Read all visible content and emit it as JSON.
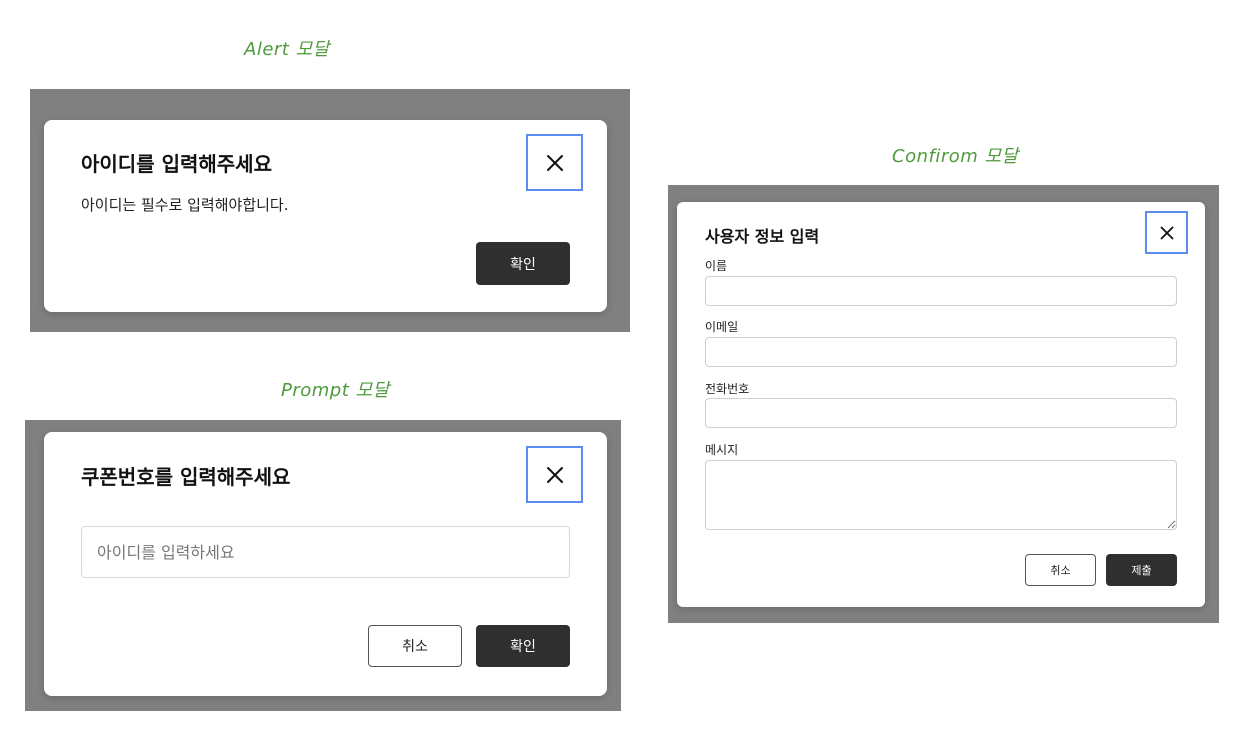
{
  "alert": {
    "caption": "Alert 모달",
    "title": "아이디를 입력해주세요",
    "message": "아이디는 필수로 입력해야합니다.",
    "close_icon": "close-icon",
    "confirm_label": "확인"
  },
  "prompt": {
    "caption": "Prompt 모달",
    "title": "쿠폰번호를 입력해주세요",
    "input_value": "",
    "input_placeholder": "아이디를 입력하세요",
    "close_icon": "close-icon",
    "cancel_label": "취소",
    "confirm_label": "확인"
  },
  "confirm": {
    "caption": "Confirom 모달",
    "title": "사용자 정보 입력",
    "close_icon": "close-icon",
    "fields": {
      "name_label": "이름",
      "email_label": "이메일",
      "phone_label": "전화번호",
      "message_label": "메시지"
    },
    "cancel_label": "취소",
    "submit_label": "제출"
  },
  "colors": {
    "overlay": "#808080",
    "caption": "#4f9a3c",
    "close_border": "#5b8def",
    "primary_button": "#2f2f2f"
  }
}
